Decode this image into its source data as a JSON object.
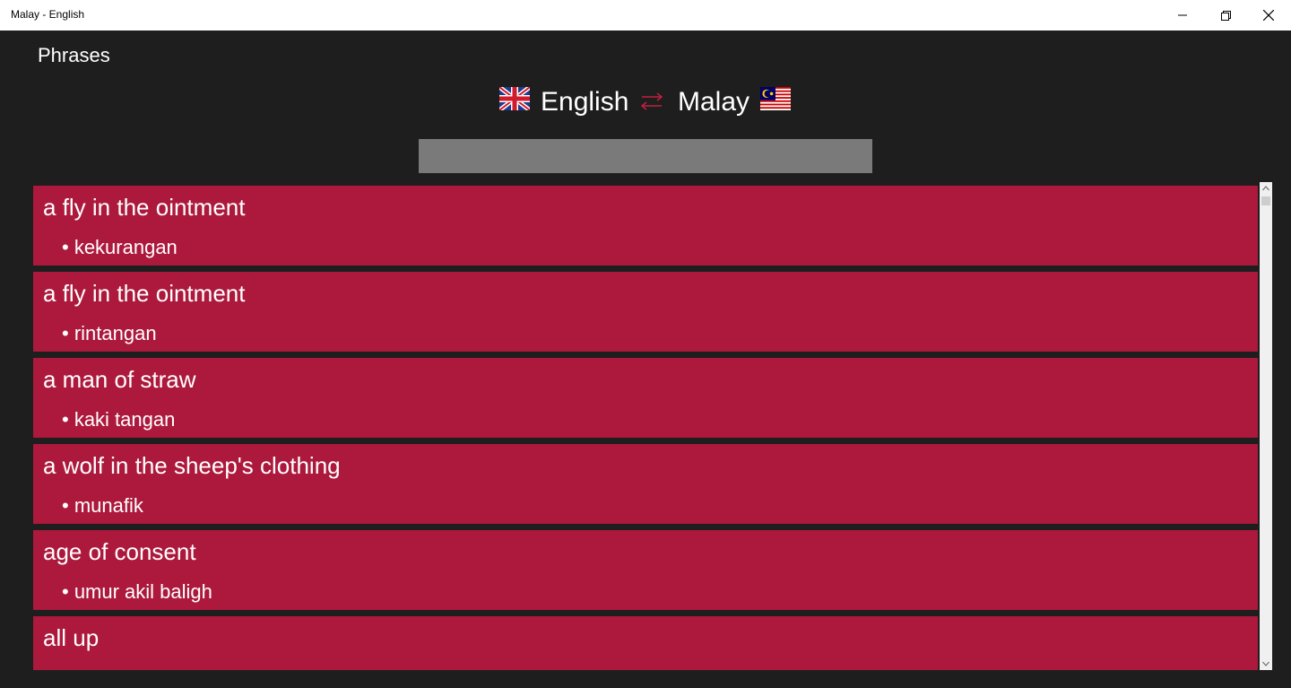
{
  "window": {
    "title": "Malay - English",
    "controls": [
      "minimize-icon",
      "restore-icon",
      "close-icon"
    ]
  },
  "page": {
    "title": "Phrases"
  },
  "languages": {
    "from": "English",
    "to": "Malay",
    "from_flag": "uk-flag-icon",
    "to_flag": "malaysia-flag-icon",
    "swap_icon": "swap-arrows-icon"
  },
  "search": {
    "value": "",
    "placeholder": ""
  },
  "colors": {
    "background": "#1e1e1e",
    "card": "#ac193c",
    "accent_swap": "#c0203f",
    "search_bg": "#7a7a7a"
  },
  "phrases": [
    {
      "phrase": "a fly in the ointment",
      "translation": "• kekurangan"
    },
    {
      "phrase": "a fly in the ointment",
      "translation": "• rintangan"
    },
    {
      "phrase": "a man of straw",
      "translation": "• kaki tangan"
    },
    {
      "phrase": "a wolf in the sheep's clothing",
      "translation": "• munafik"
    },
    {
      "phrase": "age of consent",
      "translation": "• umur akil baligh"
    },
    {
      "phrase": "all up",
      "translation": ""
    }
  ]
}
